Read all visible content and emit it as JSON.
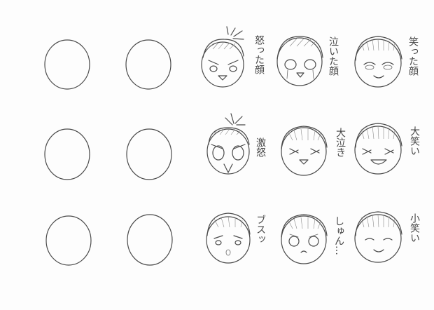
{
  "labels": {
    "angry": "怒った顔",
    "crying": "泣いた顔",
    "laughing": "笑った顔",
    "rage": "激怒",
    "sobbing": "大泣き",
    "big_laugh": "大笑い",
    "pout": "ブスッ",
    "sniffle": "しゅん…",
    "smile": "小笑い"
  }
}
